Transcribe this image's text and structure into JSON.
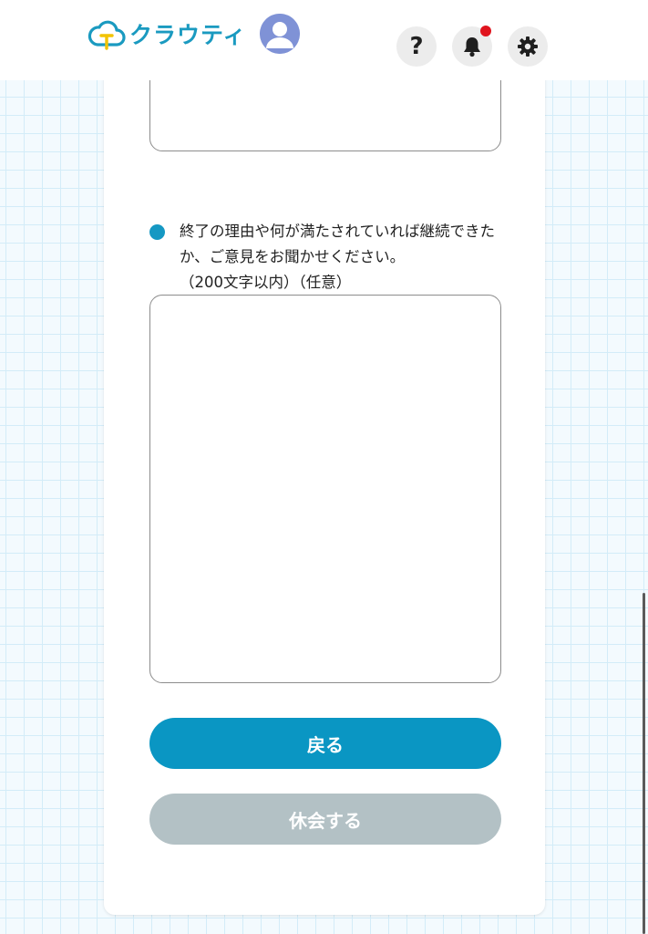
{
  "header": {
    "logo_text": "クラウティ",
    "help_label": "?",
    "notification_badge": true
  },
  "form": {
    "question_text": "終了の理由や何が満たされていれば継続できたか、ご意見をお聞かせください。",
    "question_note": "（200文字以内）（任意）",
    "top_field_value": "",
    "feedback_value": ""
  },
  "buttons": {
    "back_label": "戻る",
    "pause_label": "休会する"
  },
  "colors": {
    "brand": "#1a9ac0",
    "primary_button": "#0a96c3",
    "disabled_button": "#b3c1c5",
    "notification_dot": "#e0141e",
    "bullet": "#1598c3"
  },
  "icons": [
    "cloud-logo-icon",
    "user-avatar-icon",
    "help-icon",
    "bell-icon",
    "gear-icon"
  ]
}
